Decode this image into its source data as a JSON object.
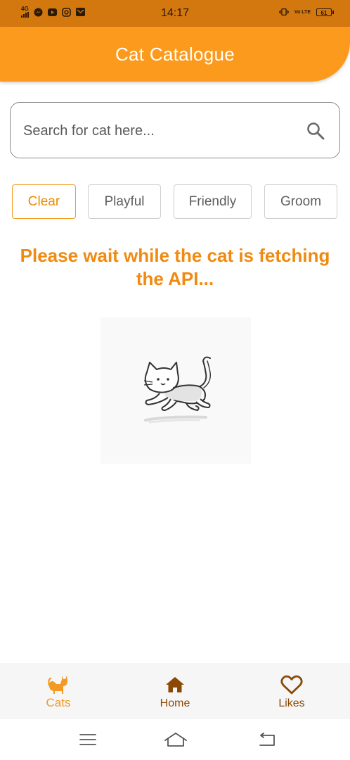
{
  "status_bar": {
    "network": "4G",
    "time": "14:17",
    "volte": "Vo LTE",
    "battery": "61"
  },
  "app_bar": {
    "title": "Cat Catalogue"
  },
  "search": {
    "placeholder": "Search for cat here...",
    "value": "",
    "icon": "search-icon"
  },
  "filters": [
    {
      "label": "Clear",
      "active": true
    },
    {
      "label": "Playful",
      "active": false
    },
    {
      "label": "Friendly",
      "active": false
    },
    {
      "label": "Groom",
      "active": false
    }
  ],
  "loading": {
    "message": "Please wait while the cat is fetching the API..."
  },
  "bottom_nav": [
    {
      "label": "Cats",
      "icon": "cat-icon",
      "active": true
    },
    {
      "label": "Home",
      "icon": "home-icon",
      "active": false
    },
    {
      "label": "Likes",
      "icon": "heart-icon",
      "active": false
    }
  ],
  "colors": {
    "primary": "#fb9a1c",
    "status_bar": "#d3770f",
    "accent_text": "#f08a10",
    "nav_dark": "#8a4a06"
  }
}
